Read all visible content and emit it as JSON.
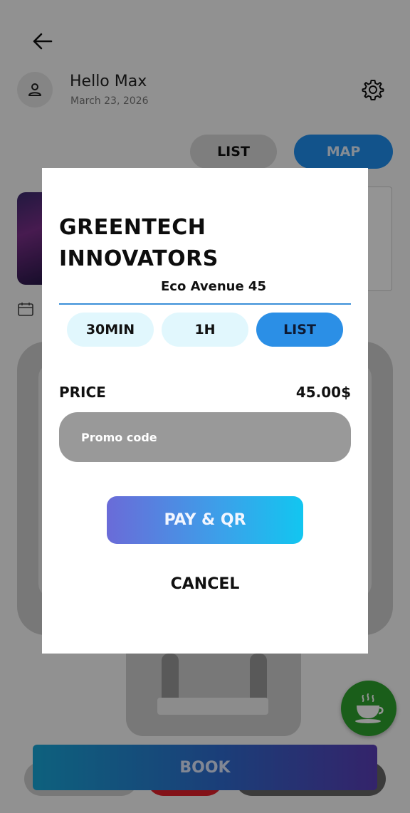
{
  "header": {
    "greeting": "Hello Max",
    "date": "March 23, 2026"
  },
  "view_tabs": {
    "list_label": "LIST",
    "map_label": "MAP"
  },
  "footer": {
    "book_label": "BOOK"
  },
  "icons": {
    "back": "arrow-left-icon",
    "avatar": "person-icon",
    "settings": "gear-icon",
    "calendar": "calendar-icon",
    "coffee": "coffee-cup-icon"
  },
  "dialog": {
    "title": "GREENTECH INNOVATORS",
    "address": "Eco Avenue 45",
    "durations": [
      {
        "label": "30MIN",
        "selected": false
      },
      {
        "label": "1H",
        "selected": false
      },
      {
        "label": "LIST",
        "selected": true
      }
    ],
    "price_label": "PRICE",
    "price_value": "45.00$",
    "promo_placeholder": "Promo code",
    "pay_label": "PAY & QR",
    "cancel_label": "CANCEL"
  },
  "colors": {
    "accent": "#2b8fe6",
    "duration_bg": "#e1f7fd",
    "promo_bg": "#999999",
    "coffee_fab": "#2ea32e"
  }
}
